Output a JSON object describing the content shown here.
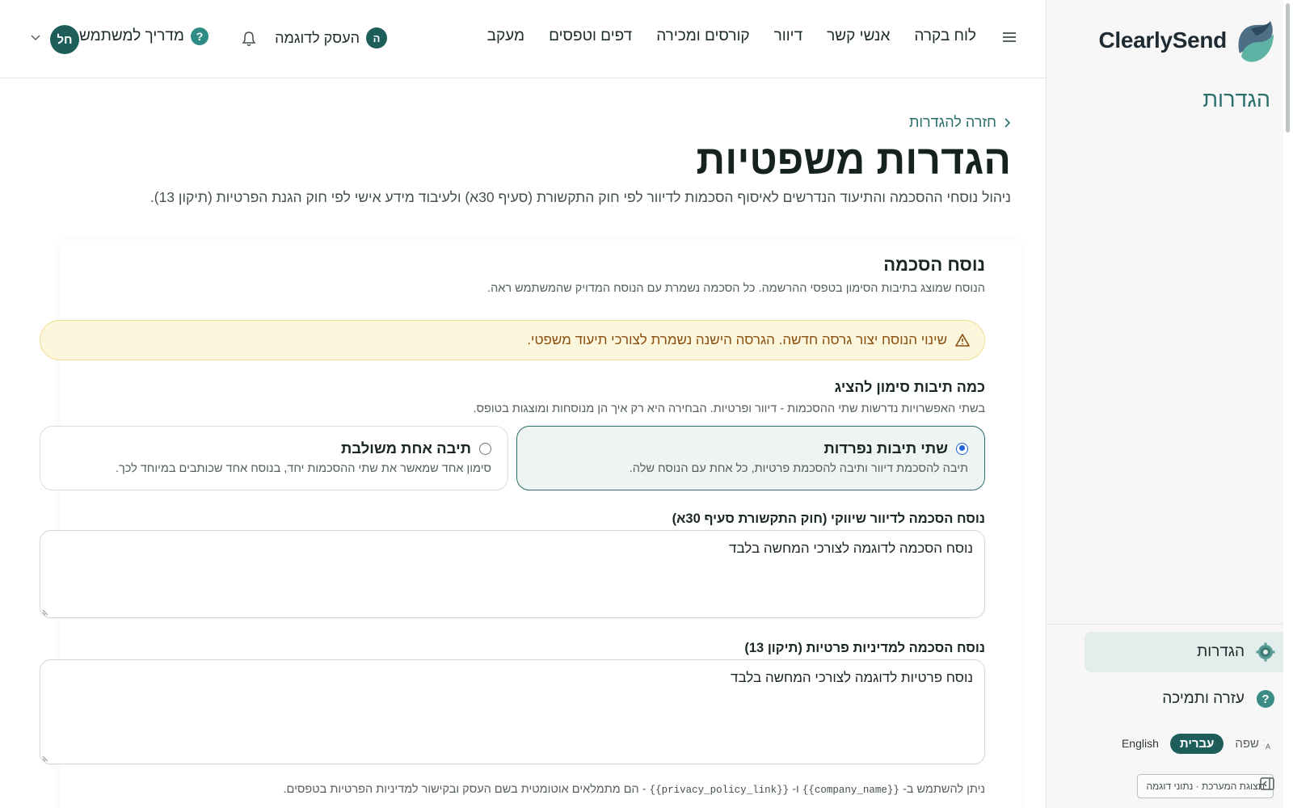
{
  "brand": {
    "name": "ClearlySend"
  },
  "sidebar": {
    "section_title": "הגדרות",
    "items": [
      {
        "label": "הגדרות",
        "icon": "gear-icon",
        "active": true
      },
      {
        "label": "עזרה ותמיכה",
        "icon": "help-icon",
        "active": false
      }
    ],
    "language": {
      "label": "שפה",
      "selected": "עברית",
      "alternative": "English"
    },
    "demo_button": "תצוגת המערכת · נתוני דוגמה"
  },
  "topbar": {
    "nav": [
      "לוח בקרה",
      "אנשי קשר",
      "דיוור",
      "קורסים ומכירה",
      "דפים וטפסים",
      "מעקב"
    ],
    "business": {
      "initial": "ה",
      "name": "העסק לדוגמה"
    },
    "guide": {
      "label": "מדריך למשתמש",
      "icon": "?"
    },
    "avatar_initials": "חל"
  },
  "page": {
    "back_link": "חזרה להגדרות",
    "title": "הגדרות משפטיות",
    "subtitle": "ניהול נוסחי ההסכמה והתיעוד הנדרשים לאיסוף הסכמות לדיוור לפי חוק התקשורת (סעיף 30א) ולעיבוד מידע אישי לפי חוק הגנת הפרטיות (תיקון 13)."
  },
  "consent_section": {
    "title": "נוסח הסכמה",
    "description": "הנוסח שמוצג בתיבות הסימון בטפסי ההרשמה. כל הסכמה נשמרת עם הנוסח המדויק שהמשתמש ראה.",
    "warning": "שינוי הנוסח יצור גרסה חדשה. הגרסה הישנה נשמרת לצורכי תיעוד משפטי.",
    "checkbox_question": {
      "title": "כמה תיבות סימון להציג",
      "description": "בשתי האפשרויות נדרשות שתי ההסכמות - דיוור ופרטיות. הבחירה היא רק איך הן מנוסחות ומוצגות בטופס.",
      "options": [
        {
          "title": "שתי תיבות נפרדות",
          "description": "תיבה להסכמת דיוור ותיבה להסכמת פרטיות, כל אחת עם הנוסח שלה.",
          "selected": true
        },
        {
          "title": "תיבה אחת משולבת",
          "description": "סימון אחד שמאשר את שתי ההסכמות יחד, בנוסח אחד שכותבים במיוחד לכך.",
          "selected": false
        }
      ]
    },
    "marketing_field": {
      "label": "נוסח הסכמה לדיוור שיווקי (חוק התקשורת סעיף 30א)",
      "value": "נוסח הסכמה לדוגמה לצורכי המחשה בלבד"
    },
    "privacy_field": {
      "label": "נוסח הסכמה למדיניות פרטיות (תיקון 13)",
      "value": "נוסח פרטיות לדוגמה לצורכי המחשה בלבד"
    },
    "hint_prefix": "ניתן להשתמש ב-",
    "hint_var1": "{{company_name}}",
    "hint_mid": "ו-",
    "hint_var2": "{{privacy_policy_link}}",
    "hint_suffix": "- הם מתמלאים אוטומטית בשם העסק ובקישור למדיניות הפרטיות בטפסים."
  },
  "colors": {
    "accent": "#1e5e5a",
    "warning_bg": "#fcf6dc",
    "warning_text": "#8a4e10",
    "radio": "#1e63d6"
  }
}
